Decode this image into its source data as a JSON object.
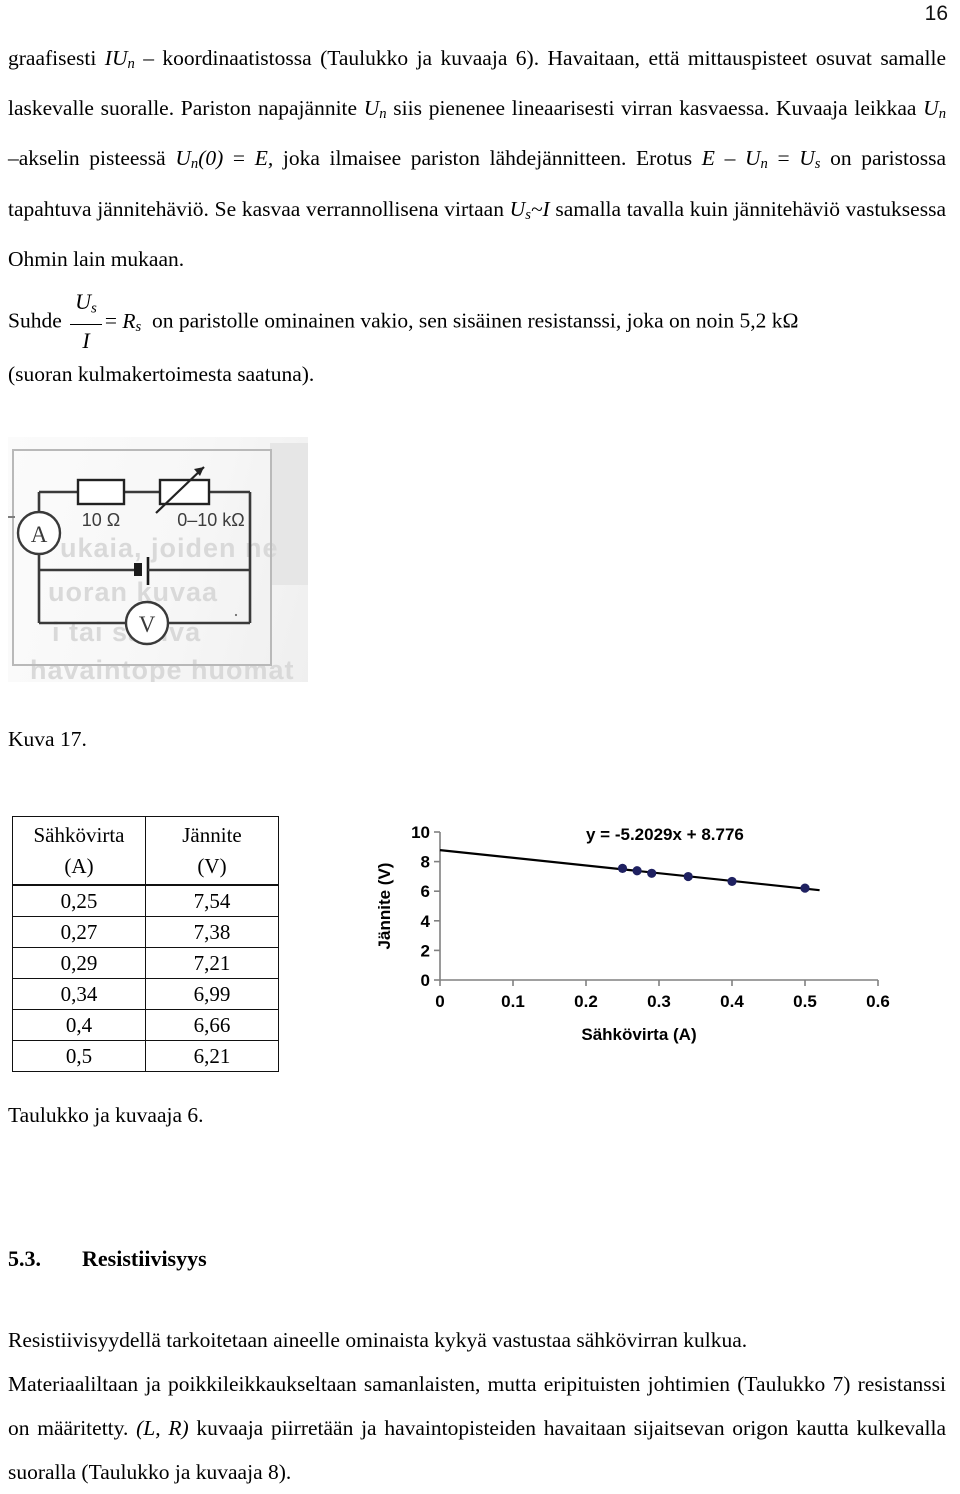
{
  "page": {
    "number": "16"
  },
  "paragraphs": {
    "p1": {
      "seg1": "graafisesti ",
      "math1": "IU",
      "math1sub": "n",
      "seg2": " – koordinaatistossa (Taulukko ja kuvaaja 6). Havaitaan, että mittauspisteet osuvat samalle laskevalle suoralle. Pariston napajännite ",
      "math2": "U",
      "math2sub": "n",
      "seg3": " siis pienenee lineaarisesti virran kasvaessa. Kuvaaja leikkaa ",
      "math3": "U",
      "math3sub": "n",
      "seg4": " –akselin pisteessä ",
      "math4": "U",
      "math4sub": "n",
      "math4tail": "(0)",
      "seg5": " = ",
      "math5": "E,",
      "seg6": " joka ilmaisee pariston lähdejännitteen. Erotus ",
      "math6": "E",
      "seg7": " – ",
      "math7": "U",
      "math7sub": "n",
      "seg8": " = ",
      "math8": "U",
      "math8sub": "s",
      "seg9": " on paristossa tapahtuva jännitehäviö. Se kasvaa verrannollisena virtaan ",
      "math9": "U",
      "math9sub": "s",
      "math9tail": "~I",
      "seg10": " samalla tavalla kuin jännitehäviö vastuksessa Ohmin lain mukaan."
    },
    "p2": {
      "lead": "Suhde",
      "frac_num": "U",
      "frac_num_sub": "s",
      "frac_den": "I",
      "equals": "=",
      "rhs": "R",
      "rhs_sub": "s",
      "tail": "on paristolle ominainen vakio, sen sisäinen resistanssi, joka on noin 5,2 kΩ"
    },
    "p3": "(suoran kulmakertoimesta saatuna).",
    "p4": "Resistiivisyydellä tarkoitetaan aineelle ominaista kykyä vastustaa sähkövirran kulkua.",
    "p5": {
      "seg1": "Materiaaliltaan ja poikkileikkaukseltaan samanlaisten, mutta eripituisten johtimien (Taulukko 7) resistanssi on määritetty. ",
      "math1": "(L, R)",
      "seg2": " kuvaaja piirretään ja havaintopisteiden havaitaan sijaitsevan origon kautta kulkevalla suoralla (Taulukko ja kuvaaja 8)."
    }
  },
  "circuit": {
    "resistor_label": "10 Ω",
    "rheostat_label": "0–10 kΩ",
    "ammeter_label": "A",
    "voltmeter_label": "V",
    "ghost_lines": [
      "ukaia, joiden ne",
      "uoran kuvaa",
      "i tai samva",
      "havaintope   huomat"
    ]
  },
  "captions": {
    "figure": "Kuva 17.",
    "table_chart": "Taulukko ja kuvaaja 6."
  },
  "table": {
    "headers": [
      {
        "name": "Sähkövirta",
        "unit": "(A)"
      },
      {
        "name": "Jännite",
        "unit": "(V)"
      }
    ],
    "rows": [
      [
        "0,25",
        "7,54"
      ],
      [
        "0,27",
        "7,38"
      ],
      [
        "0,29",
        "7,21"
      ],
      [
        "0,34",
        "6,99"
      ],
      [
        "0,4",
        "6,66"
      ],
      [
        "0,5",
        "6,21"
      ]
    ]
  },
  "chart_data": {
    "type": "scatter",
    "title": "",
    "xlabel": "Sähkövirta (A)",
    "ylabel": "Jännite (V)",
    "xlim": [
      0,
      0.6
    ],
    "ylim": [
      0,
      10
    ],
    "xticks": [
      "0",
      "0.1",
      "0.2",
      "0.3",
      "0.4",
      "0.5",
      "0.6"
    ],
    "yticks": [
      "0",
      "2",
      "4",
      "6",
      "8",
      "10"
    ],
    "grid": false,
    "legend": "none",
    "marker_color": "#1F2161",
    "trendline_color": "#000000",
    "x": [
      0.25,
      0.27,
      0.29,
      0.34,
      0.4,
      0.5
    ],
    "y": [
      7.54,
      7.38,
      7.21,
      6.99,
      6.66,
      6.21
    ],
    "trendline": {
      "equation": "y = -5.2029x + 8.776",
      "slope": -5.2029,
      "intercept": 8.776,
      "x_start": 0.0,
      "x_end": 0.52
    }
  },
  "section": {
    "number": "5.3.",
    "title": "Resistiivisyys"
  }
}
